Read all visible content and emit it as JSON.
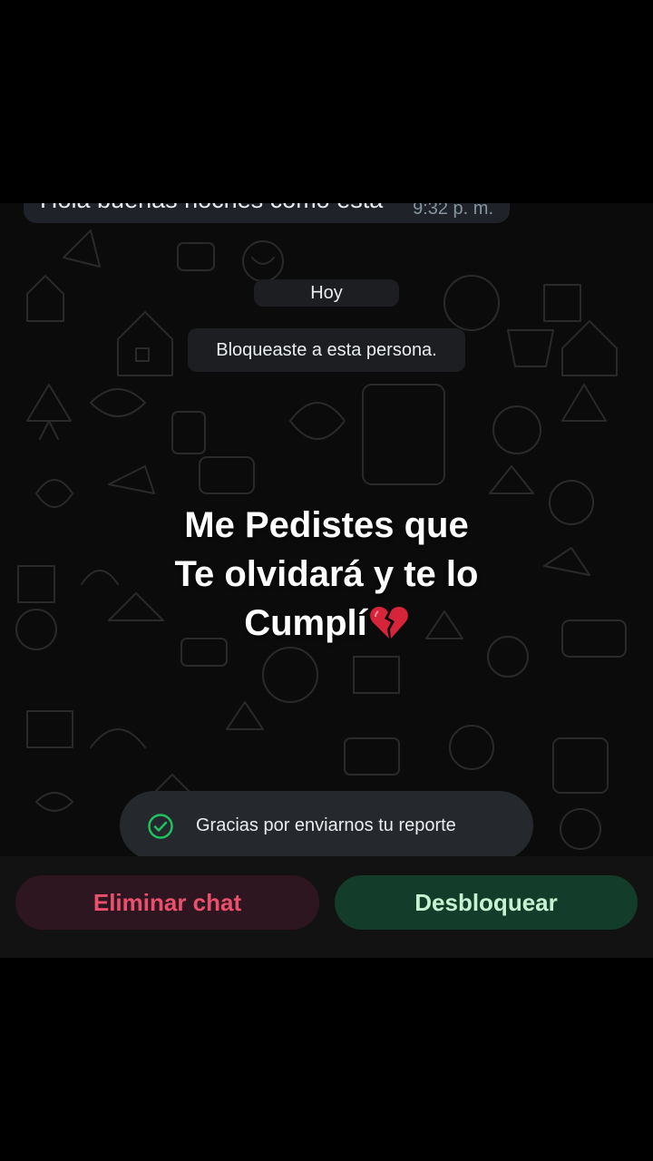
{
  "chat": {
    "last_message": {
      "text": "Hola buenas noches cómo está",
      "time": "9:32 p. m."
    },
    "date_chip": "Hoy",
    "system_message": "Bloqueaste a esta persona."
  },
  "overlay": {
    "line1": "Me Pedistes que",
    "line2": "Te olvidará y te lo",
    "line3": "Cumplí"
  },
  "toast": {
    "text": "Gracias por enviarnos tu reporte",
    "icon": "check-circle-icon"
  },
  "actions": {
    "delete_label": "Eliminar chat",
    "unblock_label": "Desbloquear"
  },
  "colors": {
    "delete_text": "#ea4f6e",
    "unblock_text": "#c6f2d1",
    "check_green": "#21c063"
  }
}
